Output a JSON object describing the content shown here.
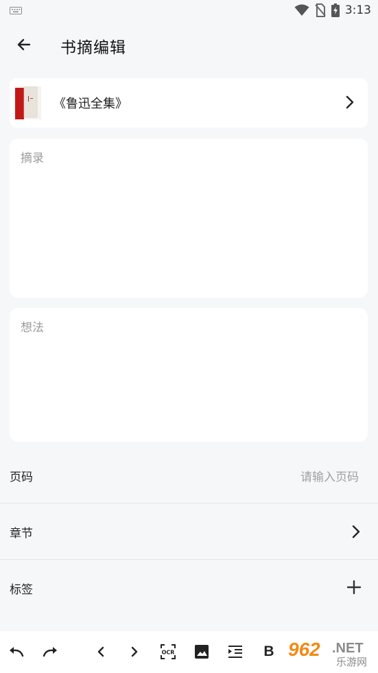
{
  "status_bar": {
    "time": "3:13"
  },
  "header": {
    "title": "书摘编辑"
  },
  "book": {
    "title": "《鲁迅全集》"
  },
  "excerpt": {
    "placeholder": "摘录"
  },
  "thought": {
    "placeholder": "想法"
  },
  "fields": {
    "page_label": "页码",
    "page_placeholder": "请输入页码",
    "chapter_label": "章节",
    "tag_label": "标签"
  },
  "toolbar": {
    "bold_label": "B",
    "ocr_label": "OCR"
  },
  "watermark": {
    "number": "962",
    "suffix": ".NET",
    "sub": "乐游网"
  },
  "colors": {
    "background": "#f6f7f9",
    "card": "#ffffff",
    "book_red": "#d32020",
    "placeholder": "#9a9a9a",
    "watermark_orange": "#f28a16"
  }
}
